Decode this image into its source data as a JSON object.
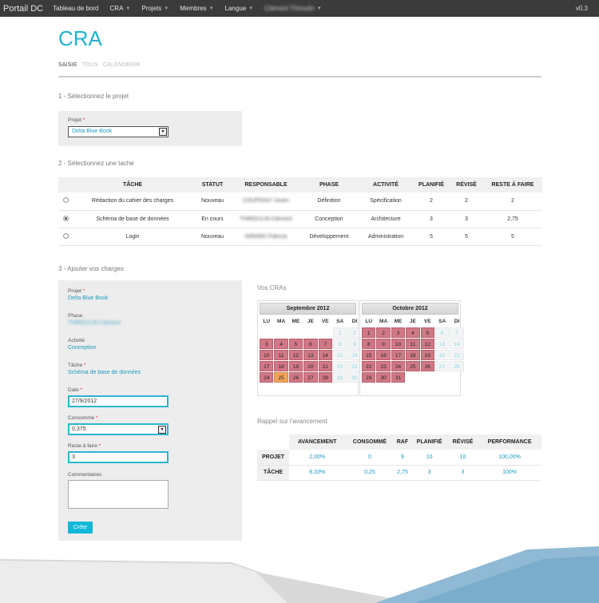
{
  "topbar": {
    "brand": "Portail DC",
    "nav": [
      {
        "label": "Tableau de bord",
        "caret": false
      },
      {
        "label": "CRA",
        "caret": true
      },
      {
        "label": "Projets",
        "caret": true
      },
      {
        "label": "Membres",
        "caret": true
      },
      {
        "label": "Langue",
        "caret": true
      },
      {
        "label": "Clément Thiroulin",
        "caret": true
      }
    ],
    "version": "v0.3"
  },
  "page": {
    "title": "CRA",
    "tabs": [
      "SAISIE",
      "TOUS",
      "CALENDRIER"
    ]
  },
  "step1": {
    "heading": "1 - Sélectionnez le projet",
    "project_label": "Projet",
    "required_mark": "*",
    "project_value": "Delta Blue Book"
  },
  "step2": {
    "heading": "2 - Sélectionnez une tache",
    "columns": [
      "TÂCHE",
      "STATUT",
      "RESPONSABLE",
      "PHASE",
      "ACTIVITÉ",
      "PLANIFIÉ",
      "RÉVISÉ",
      "RESTE À FAIRE"
    ],
    "rows": [
      {
        "selected": false,
        "task": "Rédaction du cahier des charges",
        "status": "Nouveau",
        "owner": "COUPIGNY Vivien",
        "phase": "Définition",
        "activity": "Spécification",
        "planned": "2",
        "revised": "2",
        "remaining": "2"
      },
      {
        "selected": true,
        "task": "Schéma de base de données",
        "status": "En cours",
        "owner": "THIROULIN Clément",
        "phase": "Conception",
        "activity": "Architecture",
        "planned": "3",
        "revised": "3",
        "remaining": "2,75"
      },
      {
        "selected": false,
        "task": "Login",
        "status": "Nouveau",
        "owner": "GIRARD Patricia",
        "phase": "Développement",
        "activity": "Administration",
        "planned": "5",
        "revised": "5",
        "remaining": "5"
      }
    ]
  },
  "step3": {
    "heading": "3 - Ajouter vos charges",
    "projet_label": "Projet",
    "projet_value": "Delta Blue Book",
    "phase_label": "Phase",
    "phase_value": "THIROULIN Clément",
    "activite_label": "Activité",
    "activite_value": "Conception",
    "tache_label": "Tâche",
    "tache_value": "Schéma de base de données",
    "date_label": "Date",
    "date_value": "27/9/2012",
    "consomme_label": "Consommé",
    "consomme_value": "0,375",
    "reste_label": "Reste à faire",
    "reste_value": "3",
    "commentaires_label": "Commentaires",
    "create_button": "Créer"
  },
  "calendar": {
    "label": "Vos CRAs",
    "dow": [
      "LU",
      "MA",
      "ME",
      "JE",
      "VE",
      "SA",
      "DI"
    ],
    "months": [
      {
        "title": "Septembre 2012",
        "days": [
          {
            "d": "",
            "t": "empty"
          },
          {
            "d": "",
            "t": "empty"
          },
          {
            "d": "",
            "t": "empty"
          },
          {
            "d": "",
            "t": "empty"
          },
          {
            "d": "",
            "t": "empty"
          },
          {
            "d": "1",
            "t": "we"
          },
          {
            "d": "2",
            "t": "we"
          },
          {
            "d": "3",
            "t": "filled"
          },
          {
            "d": "4",
            "t": "filled"
          },
          {
            "d": "5",
            "t": "filled"
          },
          {
            "d": "6",
            "t": "filled"
          },
          {
            "d": "7",
            "t": "filled"
          },
          {
            "d": "8",
            "t": "we"
          },
          {
            "d": "9",
            "t": "we"
          },
          {
            "d": "10",
            "t": "filled"
          },
          {
            "d": "11",
            "t": "filled"
          },
          {
            "d": "12",
            "t": "filled"
          },
          {
            "d": "13",
            "t": "filled"
          },
          {
            "d": "14",
            "t": "filled"
          },
          {
            "d": "15",
            "t": "we"
          },
          {
            "d": "16",
            "t": "we"
          },
          {
            "d": "17",
            "t": "filled"
          },
          {
            "d": "18",
            "t": "filled"
          },
          {
            "d": "19",
            "t": "filled"
          },
          {
            "d": "20",
            "t": "filled"
          },
          {
            "d": "21",
            "t": "filled"
          },
          {
            "d": "22",
            "t": "we"
          },
          {
            "d": "23",
            "t": "we"
          },
          {
            "d": "24",
            "t": "filled"
          },
          {
            "d": "25",
            "t": "today"
          },
          {
            "d": "26",
            "t": "filled"
          },
          {
            "d": "27",
            "t": "filled"
          },
          {
            "d": "28",
            "t": "filled"
          },
          {
            "d": "29",
            "t": "we"
          },
          {
            "d": "30",
            "t": "we"
          }
        ]
      },
      {
        "title": "Octobre 2012",
        "days": [
          {
            "d": "1",
            "t": "filled"
          },
          {
            "d": "2",
            "t": "filled"
          },
          {
            "d": "3",
            "t": "filled"
          },
          {
            "d": "4",
            "t": "filled"
          },
          {
            "d": "5",
            "t": "filled"
          },
          {
            "d": "6",
            "t": "we"
          },
          {
            "d": "7",
            "t": "we"
          },
          {
            "d": "8",
            "t": "filled"
          },
          {
            "d": "9",
            "t": "filled"
          },
          {
            "d": "10",
            "t": "filled"
          },
          {
            "d": "11",
            "t": "filled"
          },
          {
            "d": "12",
            "t": "filled"
          },
          {
            "d": "13",
            "t": "we"
          },
          {
            "d": "14",
            "t": "we"
          },
          {
            "d": "15",
            "t": "filled"
          },
          {
            "d": "16",
            "t": "filled"
          },
          {
            "d": "17",
            "t": "filled"
          },
          {
            "d": "18",
            "t": "filled"
          },
          {
            "d": "19",
            "t": "filled"
          },
          {
            "d": "20",
            "t": "we"
          },
          {
            "d": "21",
            "t": "we"
          },
          {
            "d": "22",
            "t": "filled"
          },
          {
            "d": "23",
            "t": "filled"
          },
          {
            "d": "24",
            "t": "filled"
          },
          {
            "d": "25",
            "t": "filled"
          },
          {
            "d": "26",
            "t": "filled"
          },
          {
            "d": "27",
            "t": "we"
          },
          {
            "d": "28",
            "t": "we"
          },
          {
            "d": "29",
            "t": "filled"
          },
          {
            "d": "30",
            "t": "filled"
          },
          {
            "d": "31",
            "t": "filled"
          },
          {
            "d": "",
            "t": "empty"
          },
          {
            "d": "",
            "t": "empty"
          },
          {
            "d": "",
            "t": "empty"
          },
          {
            "d": "",
            "t": "empty"
          }
        ]
      }
    ]
  },
  "progress": {
    "label": "Rappel sur l'avancement",
    "columns": [
      "",
      "AVANCEMENT",
      "CONSOMMÉ",
      "RAF",
      "PLANIFIÉ",
      "RÉVISÉ",
      "PERFORMANCE"
    ],
    "rows": [
      [
        "PROJET",
        "2,00%",
        "0",
        "9",
        "10",
        "10",
        "100,00%"
      ],
      [
        "TÂCHE",
        "8,33%",
        "0,25",
        "2,75",
        "3",
        "3",
        "100%"
      ]
    ]
  },
  "colors": {
    "accent": "#12b8d8",
    "filled_day": "#d07886",
    "today": "#f0a35a",
    "topbar": "#3b3b3b"
  }
}
